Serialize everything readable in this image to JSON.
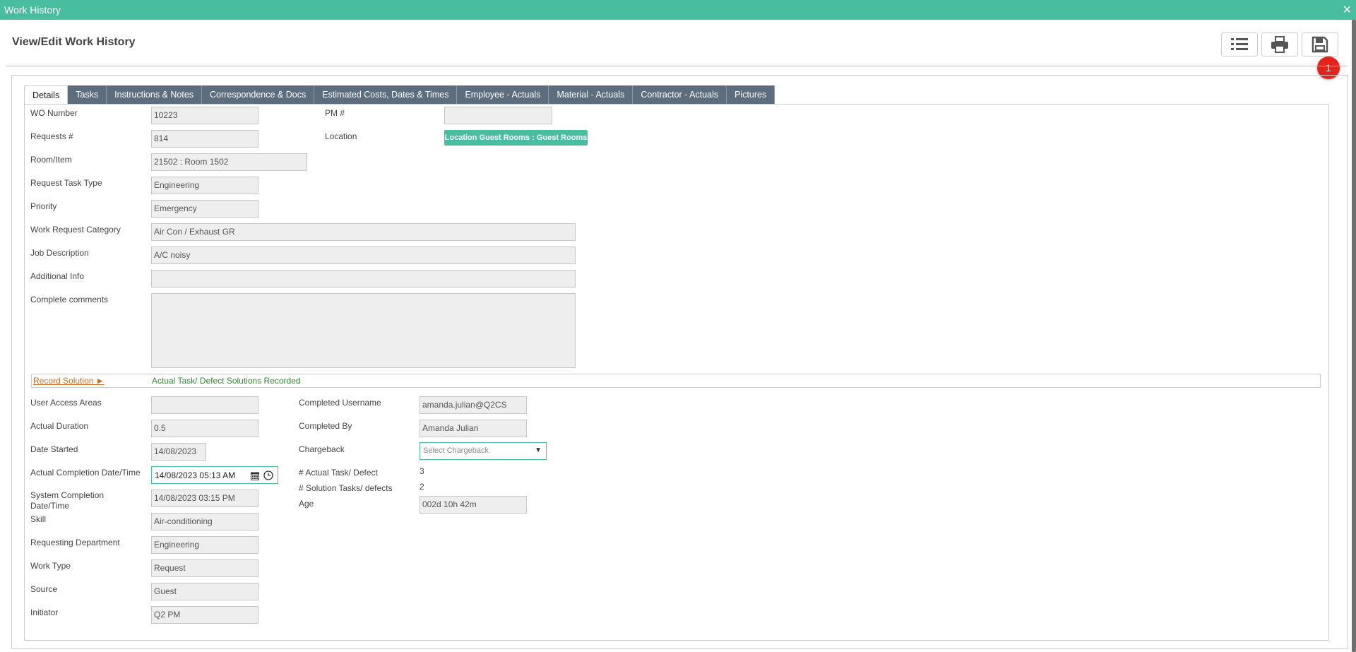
{
  "window": {
    "title": "Work History",
    "close": "✕"
  },
  "page": {
    "title": "View/Edit Work History"
  },
  "toolbar": {
    "badge": "1"
  },
  "tabs": [
    "Details",
    "Tasks",
    "Instructions & Notes",
    "Correspondence & Docs",
    "Estimated Costs, Dates & Times",
    "Employee - Actuals",
    "Material - Actuals",
    "Contractor - Actuals",
    "Pictures"
  ],
  "details": {
    "wo_number": {
      "label": "WO Number",
      "value": "10223"
    },
    "requests": {
      "label": "Requests #",
      "value": "814"
    },
    "room_item": {
      "label": "Room/Item",
      "value": "21502 : Room 1502"
    },
    "task_type": {
      "label": "Request Task Type",
      "value": "Engineering"
    },
    "priority": {
      "label": "Priority",
      "value": "Emergency"
    },
    "category": {
      "label": "Work Request Category",
      "value": "Air Con / Exhaust GR"
    },
    "job_description": {
      "label": "Job Description",
      "value": "A/C noisy"
    },
    "additional_info": {
      "label": "Additional Info",
      "value": ""
    },
    "complete_comments": {
      "label": "Complete comments",
      "value": ""
    },
    "pm": {
      "label": "PM #",
      "value": ""
    },
    "location": {
      "label": "Location",
      "value": "Location Guest Rooms : Guest Rooms"
    }
  },
  "solution": {
    "link": "Record Solution ►",
    "text": "Actual Task/ Defect Solutions Recorded"
  },
  "lower_left": {
    "user_access": {
      "label": "User Access Areas",
      "value": ""
    },
    "actual_duration": {
      "label": "Actual Duration",
      "value": "0.5"
    },
    "date_started": {
      "label": "Date Started",
      "value": "14/08/2023"
    },
    "actual_completion": {
      "label": "Actual Completion Date/Time",
      "value": "14/08/2023 05:13 AM"
    },
    "system_completion": {
      "label_1": "System Completion",
      "label_2": "Date/Time",
      "value": "14/08/2023 03:15 PM"
    },
    "skill": {
      "label": "Skill",
      "value": "Air-conditioning"
    },
    "requesting_dept": {
      "label": "Requesting Department",
      "value": "Engineering"
    },
    "work_type": {
      "label": "Work Type",
      "value": "Request"
    },
    "source": {
      "label": "Source",
      "value": "Guest"
    },
    "initiator": {
      "label": "Initiator",
      "value": "Q2 PM"
    }
  },
  "lower_right": {
    "completed_username": {
      "label": "Completed Username",
      "value": "amanda.julian@Q2CS"
    },
    "completed_by": {
      "label": "Completed By",
      "value": "Amanda Julian"
    },
    "chargeback": {
      "label": "Chargeback",
      "placeholder": "Select Chargeback"
    },
    "actual_task_defect": {
      "label": "# Actual Task/ Defect",
      "value": "3"
    },
    "solution_tasks": {
      "label": "# Solution Tasks/ defects",
      "value": "2"
    },
    "age": {
      "label": "Age",
      "value": "002d 10h 42m"
    }
  },
  "colors": {
    "accent": "#49bd9f",
    "tab_bg": "#5d6d7e",
    "badge": "#e2231a",
    "link": "#d36b1f",
    "success": "#2e8b2e"
  }
}
